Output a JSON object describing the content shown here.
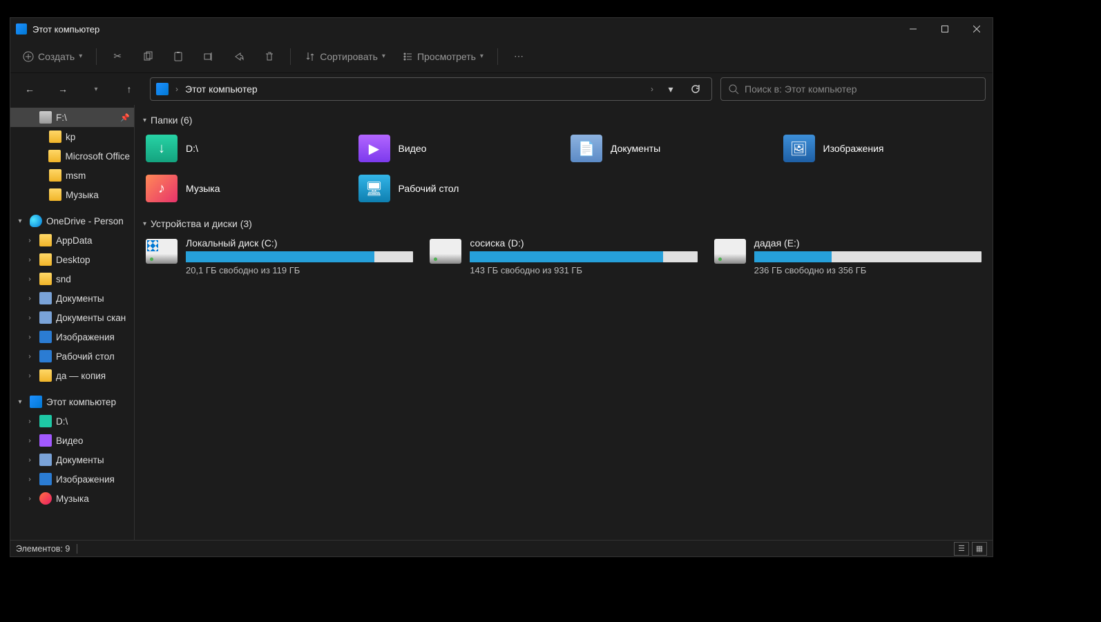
{
  "title": "Этот компьютер",
  "toolbar": {
    "create": "Создать",
    "sort": "Сортировать",
    "view": "Просмотреть"
  },
  "address": {
    "path": "Этот компьютер"
  },
  "search": {
    "placeholder": "Поиск в: Этот компьютер"
  },
  "sidebar": {
    "top": [
      {
        "label": "F:\\",
        "icon": "drive",
        "selected": true,
        "pinned": true
      },
      {
        "label": "kp",
        "icon": "folder"
      },
      {
        "label": "Microsoft Office",
        "icon": "folder"
      },
      {
        "label": "msm",
        "icon": "folder"
      },
      {
        "label": "Музыка",
        "icon": "folder"
      }
    ],
    "onedrive": {
      "label": "OneDrive - Person",
      "items": [
        {
          "label": "AppData",
          "icon": "folder"
        },
        {
          "label": "Desktop",
          "icon": "folder"
        },
        {
          "label": "snd",
          "icon": "folder"
        },
        {
          "label": "Документы",
          "icon": "docs"
        },
        {
          "label": "Документы скан",
          "icon": "docs"
        },
        {
          "label": "Изображения",
          "icon": "pics"
        },
        {
          "label": "Рабочий стол",
          "icon": "pics"
        },
        {
          "label": "да — копия",
          "icon": "folder"
        }
      ]
    },
    "thispc": {
      "label": "Этот компьютер",
      "items": [
        {
          "label": "D:\\",
          "icon": "dl"
        },
        {
          "label": "Видео",
          "icon": "video"
        },
        {
          "label": "Документы",
          "icon": "docs"
        },
        {
          "label": "Изображения",
          "icon": "pics"
        },
        {
          "label": "Музыка",
          "icon": "music"
        }
      ]
    }
  },
  "sections": {
    "folders": {
      "header": "Папки (6)",
      "items": [
        {
          "label": "D:\\",
          "cls": "fi-dl",
          "glyph": "↓"
        },
        {
          "label": "Видео",
          "cls": "fi-video",
          "glyph": "▶"
        },
        {
          "label": "Документы",
          "cls": "fi-docs",
          "glyph": "📄"
        },
        {
          "label": "Изображения",
          "cls": "fi-pics",
          "glyph": "🖼"
        },
        {
          "label": "Музыка",
          "cls": "fi-music",
          "glyph": "♪"
        },
        {
          "label": "Рабочий стол",
          "cls": "fi-desk",
          "glyph": "🖥"
        }
      ]
    },
    "drives": {
      "header": "Устройства и диски (3)",
      "items": [
        {
          "name": "Локальный диск (C:)",
          "status": "20,1 ГБ свободно из 119 ГБ",
          "fill": 83,
          "os": true
        },
        {
          "name": "сосиска (D:)",
          "status": "143 ГБ свободно из 931 ГБ",
          "fill": 85,
          "os": false
        },
        {
          "name": "дадая (E:)",
          "status": "236 ГБ свободно из 356 ГБ",
          "fill": 34,
          "os": false
        }
      ]
    }
  },
  "status": {
    "items": "Элементов: 9"
  }
}
